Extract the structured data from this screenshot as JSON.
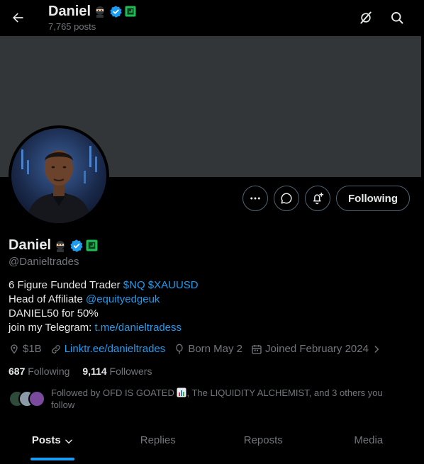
{
  "header": {
    "title": "Daniel",
    "posts_count": "7,765 posts"
  },
  "icons": {
    "back": "arrow-left-icon",
    "grok": "grok-icon",
    "search": "search-icon",
    "more": "more-icon",
    "message": "message-icon",
    "notify": "notification-bell-icon",
    "verified": "verified-badge-icon",
    "ninja": "ninja-emoji-icon",
    "affiliate": "affiliate-badge-icon",
    "money": "money-icon",
    "link": "link-icon",
    "balloon": "birthday-balloon-icon",
    "calendar": "calendar-icon",
    "chevron": "chevron-right-icon",
    "tab_chevron": "chevron-down-icon",
    "chart": "chart-emoji-icon"
  },
  "actions": {
    "following_label": "Following"
  },
  "profile": {
    "name": "Daniel",
    "handle": "@Danieltrades",
    "bio": {
      "line1_text": "6 Figure Funded Trader ",
      "line1_cashtags": "$NQ $XAUUSD",
      "line2_text": "Head of Affiliate ",
      "line2_mention": "@equityedgeuk",
      "line3_text": "DANIEL50 for 50%",
      "line4_text": "join my Telegram: ",
      "line4_link": "t.me/danieltradess"
    },
    "meta": {
      "money": "$1B",
      "link": "Linktr.ee/danieltrades",
      "born": "Born May 2",
      "joined": "Joined February 2024"
    },
    "stats": {
      "following_count": "687",
      "following_label": "Following",
      "followers_count": "9,114",
      "followers_label": "Followers"
    },
    "followed_by": {
      "prefix": "Followed by OFD IS GOATED ",
      "rest": ", The LIQUIDITY ALCHEMIST, and 3 others you follow"
    }
  },
  "tabs": [
    {
      "label": "Posts"
    },
    {
      "label": "Replies"
    },
    {
      "label": "Reposts"
    },
    {
      "label": "Media"
    }
  ],
  "colors": {
    "accent": "#1d9bf0",
    "background": "#000000",
    "banner": "#333639",
    "muted_text": "#71767b",
    "primary_text": "#e7e9ea",
    "affiliate_green": "#1fb955"
  }
}
